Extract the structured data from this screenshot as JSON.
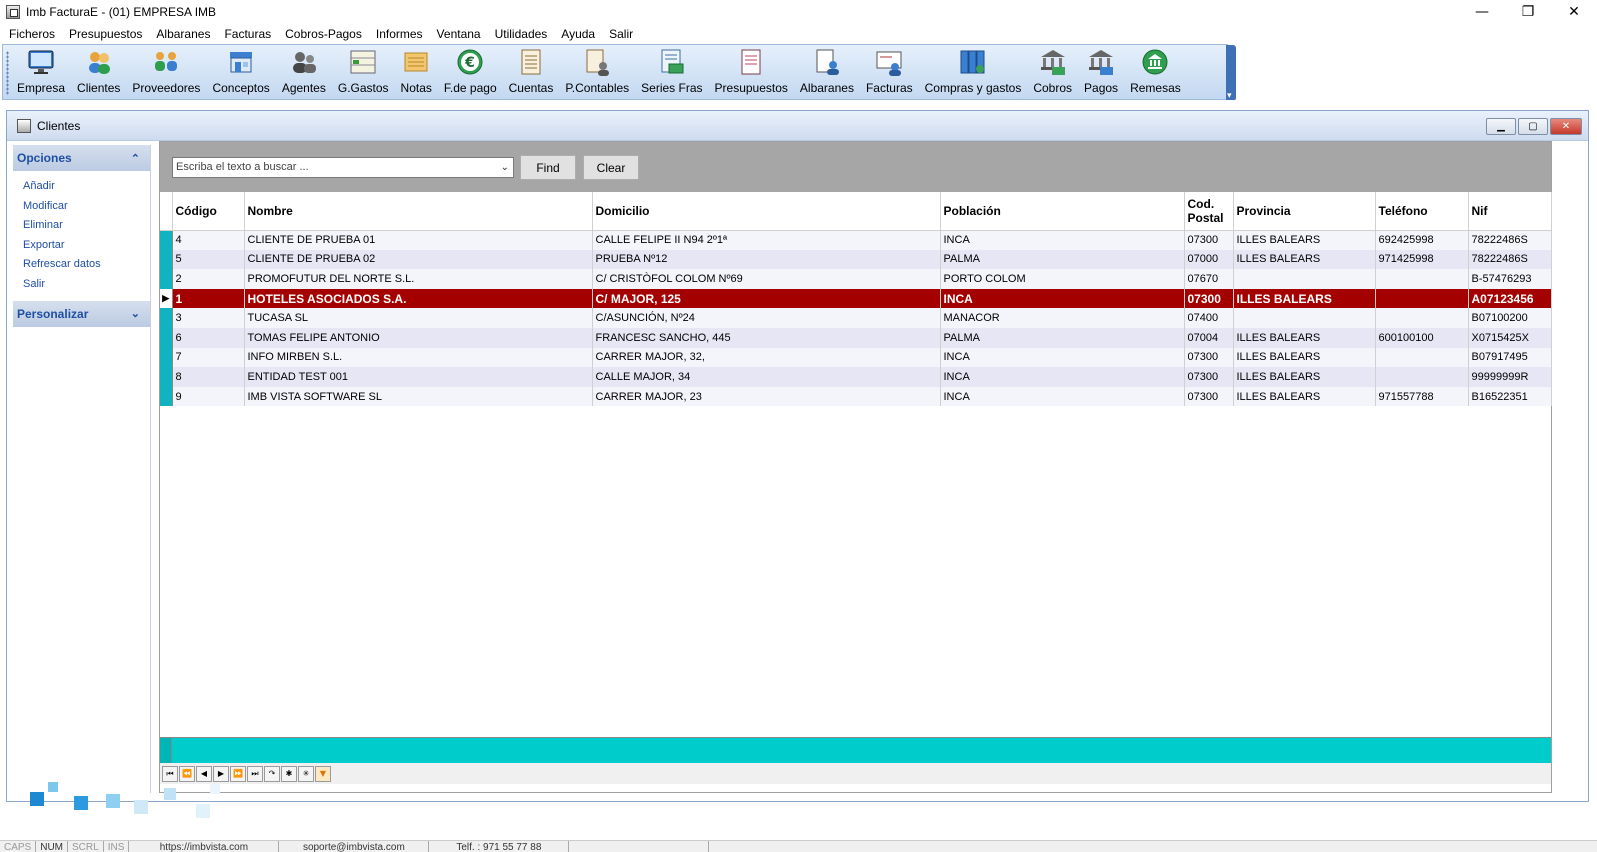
{
  "window": {
    "title": "Imb FacturaE - (01)   EMPRESA IMB",
    "minimize": "—",
    "restore": "❐",
    "close": "✕"
  },
  "menu": [
    "Ficheros",
    "Presupuestos",
    "Albaranes",
    "Facturas",
    "Cobros-Pagos",
    "Informes",
    "Ventana",
    "Utilidades",
    "Ayuda",
    "Salir"
  ],
  "toolbar": [
    {
      "label": "Empresa",
      "icon": "monitor-icon"
    },
    {
      "label": "Clientes",
      "icon": "clients-icon"
    },
    {
      "label": "Proveedores",
      "icon": "suppliers-icon"
    },
    {
      "label": "Conceptos",
      "icon": "store-icon"
    },
    {
      "label": "Agentes",
      "icon": "agents-icon"
    },
    {
      "label": "G.Gastos",
      "icon": "expenses-icon"
    },
    {
      "label": "Notas",
      "icon": "notes-icon"
    },
    {
      "label": "F.de pago",
      "icon": "euro-icon"
    },
    {
      "label": "Cuentas",
      "icon": "ledger-icon"
    },
    {
      "label": "P.Contables",
      "icon": "accounting-icon"
    },
    {
      "label": "Series Fras",
      "icon": "series-icon"
    },
    {
      "label": "Presupuestos",
      "icon": "quote-icon"
    },
    {
      "label": "Albaranes",
      "icon": "delivery-note-icon"
    },
    {
      "label": "Facturas",
      "icon": "invoice-icon"
    },
    {
      "label": "Compras y gastos",
      "icon": "purchases-icon"
    },
    {
      "label": "Cobros",
      "icon": "bank-in-icon"
    },
    {
      "label": "Pagos",
      "icon": "bank-out-icon"
    },
    {
      "label": "Remesas",
      "icon": "remittance-icon"
    }
  ],
  "child": {
    "title": "Clientes"
  },
  "sidebar": {
    "opciones": {
      "title": "Opciones",
      "chevron": "⌃",
      "items": [
        "Añadir",
        "Modificar",
        "Eliminar",
        "Exportar",
        "Refrescar datos",
        "Salir"
      ]
    },
    "personalizar": {
      "title": "Personalizar",
      "chevron": "⌄"
    }
  },
  "search": {
    "placeholder": "Escriba el texto a buscar ...",
    "find": "Find",
    "clear": "Clear"
  },
  "columns": [
    "Código",
    "Nombre",
    "Domicilio",
    "Población",
    "Cod. Postal",
    "Provincia",
    "Teléfono",
    "Nif"
  ],
  "rows": [
    [
      "4",
      "CLIENTE DE PRUEBA 01",
      "CALLE FELIPE II N94 2º1ª",
      "INCA",
      "07300",
      "ILLES BALEARS",
      "692425998",
      "78222486S"
    ],
    [
      "5",
      "CLIENTE DE PRUEBA 02",
      "PRUEBA Nº12",
      "PALMA",
      "07000",
      "ILLES BALEARS",
      "971425998",
      "78222486S"
    ],
    [
      "2",
      "PROMOFUTUR DEL NORTE S.L.",
      "C/ CRISTÒFOL COLOM Nº69",
      "PORTO COLOM",
      "07670",
      "",
      "",
      "B-57476293"
    ],
    [
      "1",
      "HOTELES ASOCIADOS S.A.",
      "C/ MAJOR, 125",
      "INCA",
      "07300",
      "ILLES BALEARS",
      "",
      "A07123456"
    ],
    [
      "3",
      "TUCASA SL",
      "C/ASUNCIÓN, Nº24",
      "MANACOR",
      "07400",
      "",
      "",
      "B07100200"
    ],
    [
      "6",
      "TOMAS FELIPE ANTONIO",
      "FRANCESC SANCHO, 445",
      "PALMA",
      "07004",
      "ILLES BALEARS",
      "600100100",
      "X0715425X"
    ],
    [
      "7",
      "INFO MIRBEN S.L.",
      "CARRER MAJOR, 32,",
      "INCA",
      "07300",
      "ILLES BALEARS",
      "",
      "B07917495"
    ],
    [
      "8",
      "ENTIDAD TEST 001",
      "CALLE MAJOR, 34",
      "INCA",
      "07300",
      "ILLES BALEARS",
      "",
      "99999999R"
    ],
    [
      "9",
      "IMB VISTA SOFTWARE SL",
      "CARRER MAJOR, 23",
      "INCA",
      "07300",
      "ILLES BALEARS",
      "971557788",
      "B16522351"
    ]
  ],
  "selected_row_index": 3,
  "navigator": [
    "⏮",
    "⏪",
    "◀",
    "▶",
    "⏩",
    "⏭",
    "↷",
    "✱",
    "✳",
    "▼"
  ],
  "status": {
    "caps": "CAPS",
    "num": "NUM",
    "scrl": "SCRL",
    "ins": "INS",
    "web": "https://imbvista.com",
    "email": "soporte@imbvista.com",
    "phone": "Telf. : 971 55 77 88"
  },
  "colors": {
    "selected_row": "#a40000",
    "indicator": "#12b3c0",
    "footer": "#00cccc",
    "link": "#1f4fa2"
  }
}
